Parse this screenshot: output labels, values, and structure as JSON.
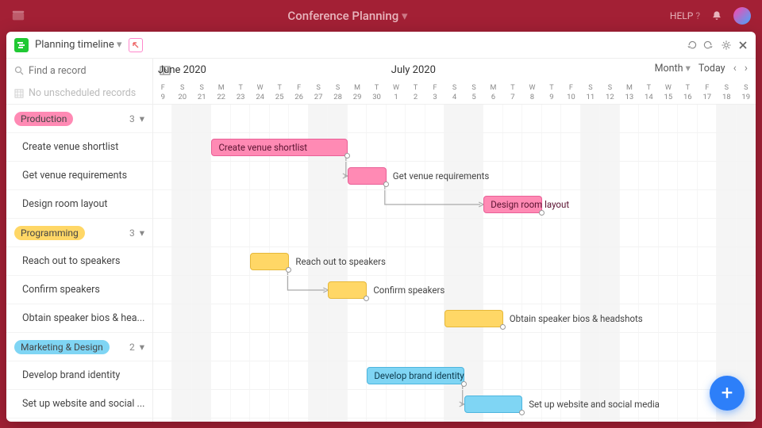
{
  "app": {
    "title": "Conference Planning",
    "help": "HELP"
  },
  "view": {
    "name": "Planning timeline"
  },
  "search": {
    "placeholder": "Find a record",
    "unscheduled": "No unscheduled records"
  },
  "controls": {
    "scale": "Month",
    "today": "Today"
  },
  "months": [
    {
      "label": "June 2020",
      "startCol": 0
    },
    {
      "label": "July 2020",
      "startCol": 12
    }
  ],
  "days": [
    {
      "w": "F",
      "d": "9"
    },
    {
      "w": "S",
      "d": "20"
    },
    {
      "w": "S",
      "d": "21"
    },
    {
      "w": "M",
      "d": "22"
    },
    {
      "w": "T",
      "d": "23"
    },
    {
      "w": "W",
      "d": "24"
    },
    {
      "w": "T",
      "d": "25"
    },
    {
      "w": "F",
      "d": "26"
    },
    {
      "w": "S",
      "d": "27"
    },
    {
      "w": "S",
      "d": "28"
    },
    {
      "w": "M",
      "d": "29"
    },
    {
      "w": "T",
      "d": "30"
    },
    {
      "w": "W",
      "d": "1"
    },
    {
      "w": "T",
      "d": "2"
    },
    {
      "w": "F",
      "d": "3"
    },
    {
      "w": "S",
      "d": "4"
    },
    {
      "w": "S",
      "d": "5"
    },
    {
      "w": "M",
      "d": "6"
    },
    {
      "w": "T",
      "d": "7"
    },
    {
      "w": "W",
      "d": "8"
    },
    {
      "w": "T",
      "d": "9"
    },
    {
      "w": "F",
      "d": "10"
    },
    {
      "w": "S",
      "d": "11"
    },
    {
      "w": "S",
      "d": "12"
    },
    {
      "w": "M",
      "d": "13"
    },
    {
      "w": "T",
      "d": "14"
    },
    {
      "w": "W",
      "d": "15"
    },
    {
      "w": "T",
      "d": "16"
    },
    {
      "w": "F",
      "d": "17"
    },
    {
      "w": "S",
      "d": "18"
    },
    {
      "w": "S",
      "d": "19"
    }
  ],
  "weekendCols": [
    1,
    2,
    8,
    9,
    15,
    16,
    22,
    23,
    29,
    30
  ],
  "groups": [
    {
      "name": "Production",
      "color": "#ff8ab4",
      "count": 3,
      "tasks": [
        {
          "name": "Create venue shortlist",
          "bar": {
            "start": 3,
            "span": 7,
            "label": "Create venue shortlist",
            "labelInside": true,
            "color": "pink"
          }
        },
        {
          "name": "Get venue requirements",
          "bar": {
            "start": 10,
            "span": 2,
            "label": "Get venue requirements",
            "labelInside": false,
            "color": "pink"
          },
          "depFromPrev": true
        },
        {
          "name": "Design room layout",
          "bar": {
            "start": 17,
            "span": 3,
            "label": "Design room layout",
            "labelInside": true,
            "color": "pink"
          },
          "depFromPrev": true
        }
      ]
    },
    {
      "name": "Programming",
      "color": "#ffd766",
      "count": 3,
      "tasks": [
        {
          "name": "Reach out to speakers",
          "bar": {
            "start": 5,
            "span": 2,
            "label": "Reach out to speakers",
            "labelInside": false,
            "color": "yellow"
          }
        },
        {
          "name": "Confirm speakers",
          "bar": {
            "start": 9,
            "span": 2,
            "label": "Confirm speakers",
            "labelInside": false,
            "color": "yellow"
          },
          "depFromPrev": true
        },
        {
          "name": "Obtain speaker bios & hea...",
          "fullLabel": "Obtain speaker bios & headshots",
          "bar": {
            "start": 15,
            "span": 3,
            "label": "Obtain speaker bios & headshots",
            "labelInside": false,
            "color": "yellow"
          }
        }
      ]
    },
    {
      "name": "Marketing & Design",
      "color": "#7fd5f4",
      "count": 2,
      "tasks": [
        {
          "name": "Develop brand identity",
          "bar": {
            "start": 11,
            "span": 5,
            "label": "Develop brand identity",
            "labelInside": true,
            "color": "blue"
          }
        },
        {
          "name": "Set up website and social ...",
          "fullLabel": "Set up website and social media",
          "bar": {
            "start": 16,
            "span": 3,
            "label": "Set up website and social media",
            "labelInside": false,
            "color": "blue"
          },
          "depFromPrev": true
        }
      ]
    }
  ],
  "colors": {
    "pink": "#ff8ab4",
    "yellow": "#ffd766",
    "blue": "#7fd5f4"
  }
}
